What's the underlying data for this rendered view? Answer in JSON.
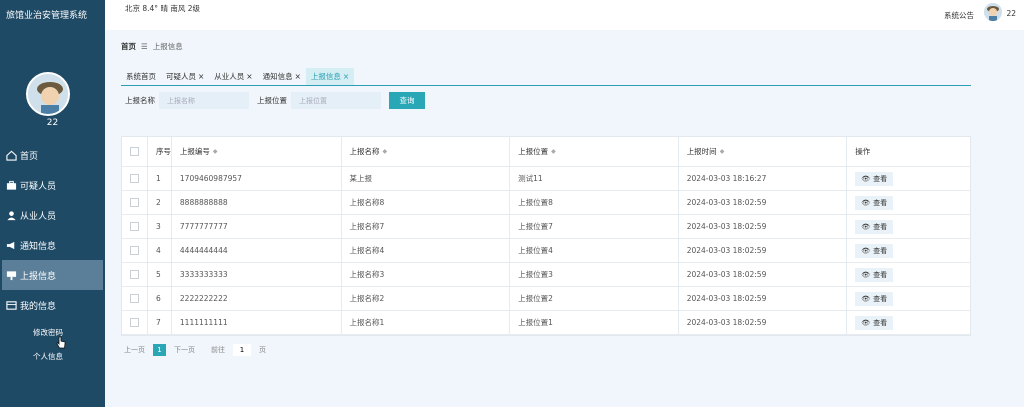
{
  "app": {
    "title": "旅馆业治安管理系统"
  },
  "sidebar": {
    "username": "22",
    "items": [
      {
        "label": "首页",
        "icon": "home-icon"
      },
      {
        "label": "可疑人员",
        "icon": "briefcase-icon"
      },
      {
        "label": "从业人员",
        "icon": "user-icon"
      },
      {
        "label": "通知信息",
        "icon": "megaphone-icon"
      },
      {
        "label": "上报信息",
        "icon": "report-icon"
      },
      {
        "label": "我的信息",
        "icon": "profile-card-icon"
      }
    ],
    "subitems": [
      {
        "label": "修改密码"
      },
      {
        "label": "个人信息"
      }
    ]
  },
  "topbar": {
    "weather": "北京  8.4°  晴  南风  2级",
    "announcement": "系统公告",
    "user": "22"
  },
  "breadcrumb": {
    "home": "首页",
    "separator": "☰",
    "current": "上报信息"
  },
  "tabs": [
    {
      "label": "系统首页",
      "closable": false
    },
    {
      "label": "可疑人员",
      "closable": true
    },
    {
      "label": "从业人员",
      "closable": true
    },
    {
      "label": "通知信息",
      "closable": true
    },
    {
      "label": "上报信息",
      "closable": true,
      "active": true
    }
  ],
  "search": {
    "name_label": "上报名称",
    "name_placeholder": "上报名称",
    "loc_label": "上报位置",
    "loc_placeholder": "上报位置",
    "button": "查询"
  },
  "table": {
    "headers": [
      "序号",
      "上报编号",
      "上报名称",
      "上报位置",
      "上报时间",
      "操作"
    ],
    "view_label": "查看",
    "rows": [
      [
        "1",
        "1709460987957",
        "某上报",
        "测试11",
        "2024-03-03 18:16:27"
      ],
      [
        "2",
        "8888888888",
        "上报名称8",
        "上报位置8",
        "2024-03-03 18:02:59"
      ],
      [
        "3",
        "7777777777",
        "上报名称7",
        "上报位置7",
        "2024-03-03 18:02:59"
      ],
      [
        "4",
        "4444444444",
        "上报名称4",
        "上报位置4",
        "2024-03-03 18:02:59"
      ],
      [
        "5",
        "3333333333",
        "上报名称3",
        "上报位置3",
        "2024-03-03 18:02:59"
      ],
      [
        "6",
        "2222222222",
        "上报名称2",
        "上报位置2",
        "2024-03-03 18:02:59"
      ],
      [
        "7",
        "1111111111",
        "上报名称1",
        "上报位置1",
        "2024-03-03 18:02:59"
      ]
    ]
  },
  "pager": {
    "prev": "上一页",
    "current": "1",
    "next": "下一页",
    "goto": "前往",
    "goto_value": "1",
    "page_unit": "页"
  },
  "colors": {
    "sidebar_bg": "#1f4a66",
    "accent": "#2aa7b7",
    "active_menu": "#5b7f98"
  }
}
